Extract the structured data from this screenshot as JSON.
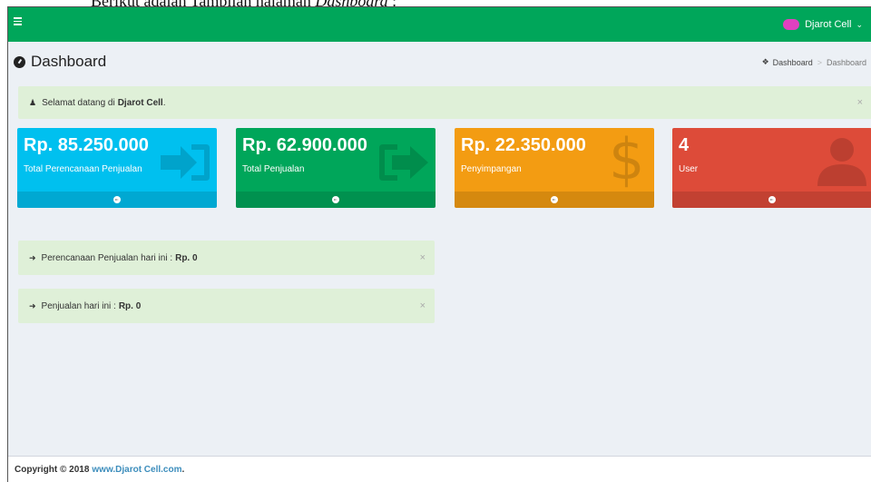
{
  "document": {
    "caption_prefix": "Berikut adalah Tampilan halaman ",
    "caption_italic": "Dashboard",
    "caption_suffix": " :"
  },
  "header": {
    "user_name": "Djarot Cell",
    "caret": "⌄"
  },
  "page": {
    "title": "Dashboard",
    "breadcrumb": [
      "Dashboard",
      "Dashboard"
    ]
  },
  "welcome": {
    "text": "Selamat datang di",
    "bold": "Djarot Cell",
    "suffix": "."
  },
  "boxes": [
    {
      "value": "Rp. 85.250.000",
      "label": "Total Perencanaan Penjualan",
      "color": "#00c0ef",
      "icon": "sign-in-icon"
    },
    {
      "value": "Rp. 62.900.000",
      "label": "Total Penjualan",
      "color": "#00a65a",
      "icon": "sign-out-icon"
    },
    {
      "value": "Rp. 22.350.000",
      "label": "Penyimpangan",
      "color": "#f39c12",
      "icon": "dollar-icon"
    },
    {
      "value": "4",
      "label": "User",
      "color": "#dd4b39",
      "icon": "user-icon"
    }
  ],
  "alerts": {
    "plan_text": "Perencanaan Penjualan hari ini :",
    "plan_value": "Rp. 0",
    "sales_text": "Penjualan hari ini :",
    "sales_value": "Rp. 0",
    "close": "×"
  },
  "footer": {
    "copyright": "Copyright © 2018",
    "link": "www.Djarot Cell.com",
    "end": "."
  }
}
